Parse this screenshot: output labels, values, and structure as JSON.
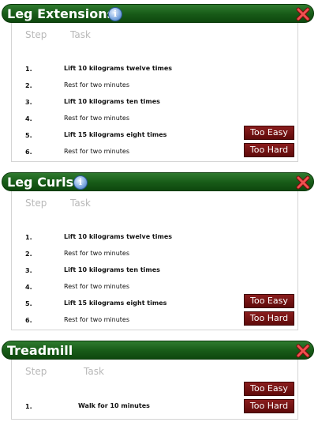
{
  "cards": [
    {
      "title": "Leg Extensions",
      "columns": {
        "step": "Step",
        "task": "Task"
      },
      "rows": [
        {
          "num": "1.",
          "task": "Lift 10 kilograms twelve times"
        },
        {
          "num": "2.",
          "task": "Rest for two minutes"
        },
        {
          "num": "3.",
          "task": "Lift 10 kilograms ten times"
        },
        {
          "num": "4.",
          "task": "Rest for two minutes"
        },
        {
          "num": "5.",
          "task": "Lift 15 kilograms eight times"
        },
        {
          "num": "6.",
          "task": "Rest for two minutes"
        }
      ],
      "buttons": {
        "easy": "Too Easy",
        "hard": "Too Hard"
      }
    },
    {
      "title": "Leg Curls",
      "columns": {
        "step": "Step",
        "task": "Task"
      },
      "rows": [
        {
          "num": "1.",
          "task": "Lift 10 kilograms twelve times"
        },
        {
          "num": "2.",
          "task": "Rest for two minutes"
        },
        {
          "num": "3.",
          "task": "Lift 10 kilograms ten times"
        },
        {
          "num": "4.",
          "task": "Rest for two minutes"
        },
        {
          "num": "5.",
          "task": "Lift 15 kilograms eight times"
        },
        {
          "num": "6.",
          "task": "Rest for two minutes"
        }
      ],
      "buttons": {
        "easy": "Too Easy",
        "hard": "Too Hard"
      }
    },
    {
      "title": "Treadmill",
      "columns": {
        "step": "Step",
        "task": "Task"
      },
      "rows": [
        {
          "num": "1.",
          "task": "Walk for 10 minutes"
        }
      ],
      "buttons": {
        "easy": "Too Easy",
        "hard": "Too Hard"
      }
    }
  ],
  "icons": {
    "info": "info-icon",
    "close": "close-icon"
  },
  "colors": {
    "header": "#175a17",
    "button": "#6e1010"
  }
}
